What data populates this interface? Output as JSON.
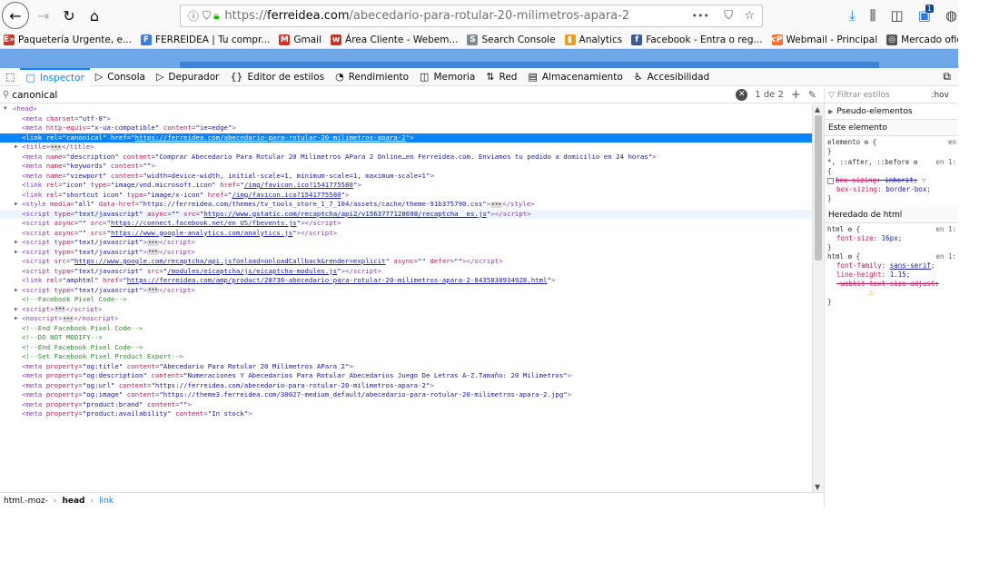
{
  "browser": {
    "url_scheme": "https://",
    "url_host": "ferreidea.com",
    "url_path": "/abecedario-para-rotular-20-milimetros-apara-2",
    "more_label": "•••",
    "notif_count": "1"
  },
  "bookmarks": [
    {
      "label": "Paquetería Urgente, e...",
      "icon": "E»",
      "color": "#c0392b"
    },
    {
      "label": "FERREIDEA | Tu compr...",
      "icon": "F",
      "color": "#3b7dd8"
    },
    {
      "label": "Gmail",
      "icon": "M",
      "color": "#d93025"
    },
    {
      "label": "Área Cliente - Webem...",
      "icon": "w",
      "color": "#c0392b"
    },
    {
      "label": "Search Console",
      "icon": "S",
      "color": "#7f8c8d"
    },
    {
      "label": "Analytics",
      "icon": "▮",
      "color": "#f39c12"
    },
    {
      "label": "Facebook - Entra o reg...",
      "icon": "f",
      "color": "#3b5998"
    },
    {
      "label": "Webmail - Principal",
      "icon": "cP",
      "color": "#ff6c2c"
    },
    {
      "label": "Mercado oficial de Pre...",
      "icon": "◎",
      "color": "#555555"
    }
  ],
  "devtools": {
    "tabs": [
      {
        "label": "Inspector",
        "icon": "▢"
      },
      {
        "label": "Consola",
        "icon": "▷"
      },
      {
        "label": "Depurador",
        "icon": "▷"
      },
      {
        "label": "Editor de estilos",
        "icon": "{}"
      },
      {
        "label": "Rendimiento",
        "icon": "◔"
      },
      {
        "label": "Memoria",
        "icon": "◫"
      },
      {
        "label": "Red",
        "icon": "⇅"
      },
      {
        "label": "Almacenamiento",
        "icon": "▤"
      },
      {
        "label": "Accesibilidad",
        "icon": "♿"
      }
    ],
    "search_value": "canonical",
    "search_count": "1 de 2",
    "breadcrumb": [
      "html.-moz-",
      "head",
      "link"
    ]
  },
  "rules": {
    "filter_placeholder": "Filtrar estilos",
    "hov": ":hov",
    "pseudo": "Pseudo-elementos",
    "this_element": "Este elemento",
    "element_selector": "elemento",
    "src_en": "en",
    "src_en1": "en 1:",
    "universal_selector": "*, ::after, ::before",
    "box_sizing_prop": "box-sizing",
    "box_sizing_inherit": "inherit",
    "box_sizing_border": "border-box",
    "inherited_title": "Heredado de html",
    "html_sel": "html",
    "font_size_prop": "font-size",
    "font_size_val": "16px",
    "font_family_prop": "font-family",
    "font_family_val": "sans-serif",
    "line_height_prop": "line-height",
    "line_height_val": "1.15",
    "webkit_prop": "-webkit-text-size-adjust"
  }
}
